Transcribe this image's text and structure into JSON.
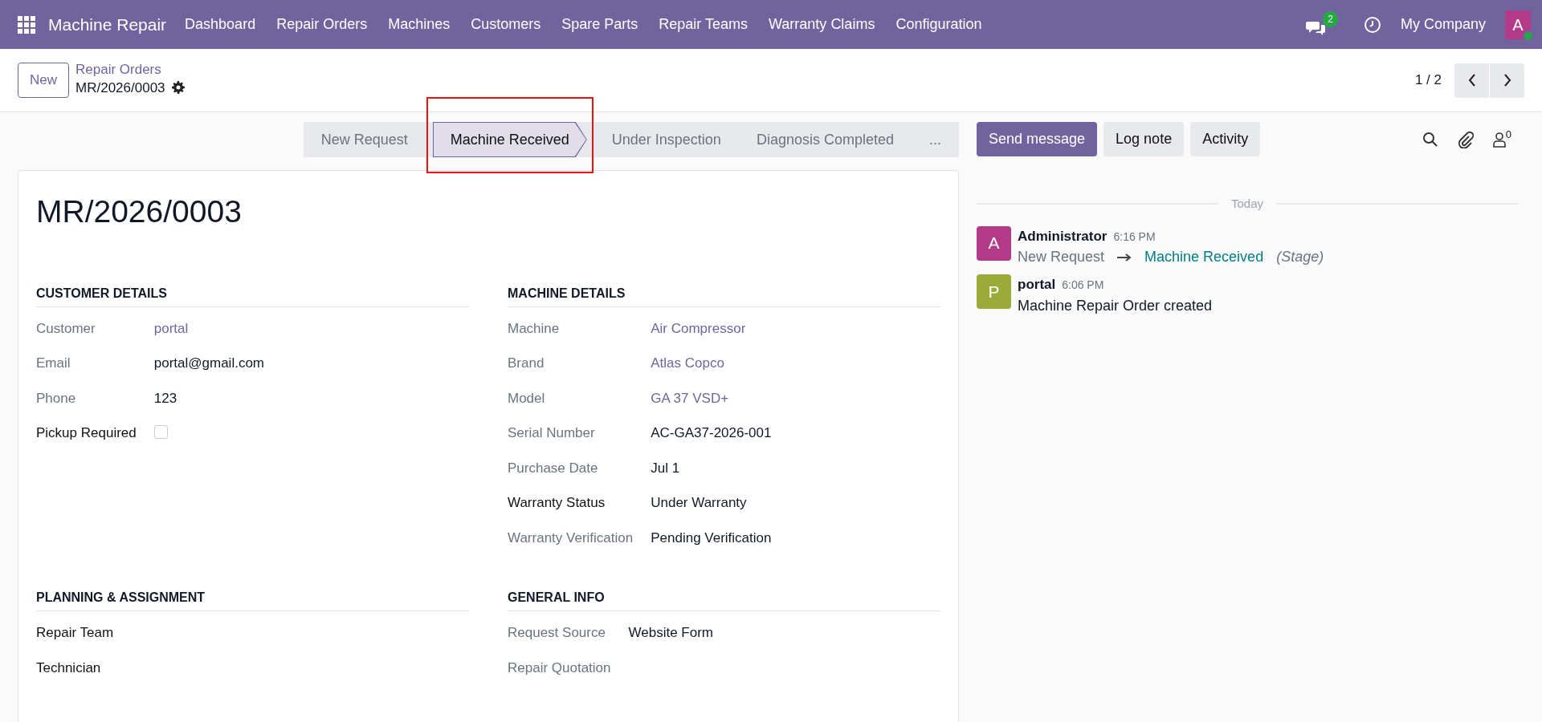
{
  "navbar": {
    "app_name": "Machine Repair",
    "menu": [
      "Dashboard",
      "Repair Orders",
      "Machines",
      "Customers",
      "Spare Parts",
      "Repair Teams",
      "Warranty Claims",
      "Configuration"
    ],
    "messages_count": "2",
    "company": "My Company",
    "user_initial": "A",
    "user_online": true
  },
  "control_panel": {
    "new_button": "New",
    "breadcrumb": "Repair Orders",
    "record_name": "MR/2026/0003",
    "pager": "1 / 2"
  },
  "stages": [
    {
      "label": "New Request",
      "selected": false,
      "highlighted": false
    },
    {
      "label": "Machine Received",
      "selected": true,
      "highlighted": true
    },
    {
      "label": "Under Inspection",
      "selected": false,
      "highlighted": false
    },
    {
      "label": "Diagnosis Completed",
      "selected": false,
      "highlighted": false
    },
    {
      "label": "...",
      "selected": false,
      "highlighted": false
    }
  ],
  "form": {
    "title": "MR/2026/0003",
    "groups": [
      {
        "title": "CUSTOMER DETAILS",
        "fields": [
          {
            "label": "Customer",
            "kind": "link",
            "value": "portal",
            "label_strong": false
          },
          {
            "label": "Email",
            "kind": "text",
            "value": "portal@gmail.com",
            "label_strong": false
          },
          {
            "label": "Phone",
            "kind": "text",
            "value": "123",
            "label_strong": false
          },
          {
            "label": "Pickup Required",
            "kind": "checkbox",
            "checked": false,
            "label_strong": true
          }
        ]
      },
      {
        "title": "MACHINE DETAILS",
        "fields": [
          {
            "label": "Machine",
            "kind": "link",
            "value": "Air Compressor",
            "label_strong": false
          },
          {
            "label": "Brand",
            "kind": "link",
            "value": "Atlas Copco",
            "label_strong": false
          },
          {
            "label": "Model",
            "kind": "link",
            "value": "GA 37 VSD+",
            "label_strong": false
          },
          {
            "label": "Serial Number",
            "kind": "text",
            "value": "AC-GA37-2026-001",
            "label_strong": false
          },
          {
            "label": "Purchase Date",
            "kind": "text",
            "value": "Jul 1",
            "label_strong": false
          },
          {
            "label": "Warranty Status",
            "kind": "text",
            "value": "Under Warranty",
            "label_strong": true
          },
          {
            "label": "Warranty Verification",
            "kind": "text",
            "value": "Pending Verification",
            "label_strong": false
          }
        ]
      },
      {
        "title": "PLANNING & ASSIGNMENT",
        "fields": [
          {
            "label": "Repair Team",
            "kind": "empty",
            "label_strong": true
          },
          {
            "label": "Technician",
            "kind": "empty",
            "label_strong": true
          }
        ]
      },
      {
        "title": "GENERAL INFO",
        "fields": [
          {
            "label": "Request Source",
            "kind": "text",
            "value": "Website Form",
            "label_strong": false
          },
          {
            "label": "Repair Quotation",
            "kind": "empty",
            "label_strong": false
          }
        ]
      }
    ]
  },
  "chatter": {
    "buttons": [
      {
        "label": "Send message",
        "selected": true
      },
      {
        "label": "Log note",
        "selected": false
      },
      {
        "label": "Activity",
        "selected": false
      }
    ],
    "followers_count": "0",
    "date_separator": "Today",
    "messages": [
      {
        "initial": "A",
        "color": "#b33a87",
        "author": "Administrator",
        "time": "6:16 PM",
        "kind": "tracking",
        "old_value": "New Request",
        "new_value": "Machine Received",
        "field": "(Stage)"
      },
      {
        "initial": "P",
        "color": "#9bab3a",
        "author": "portal",
        "time": "6:06 PM",
        "kind": "text",
        "body": "Machine Repair Order created"
      }
    ]
  }
}
